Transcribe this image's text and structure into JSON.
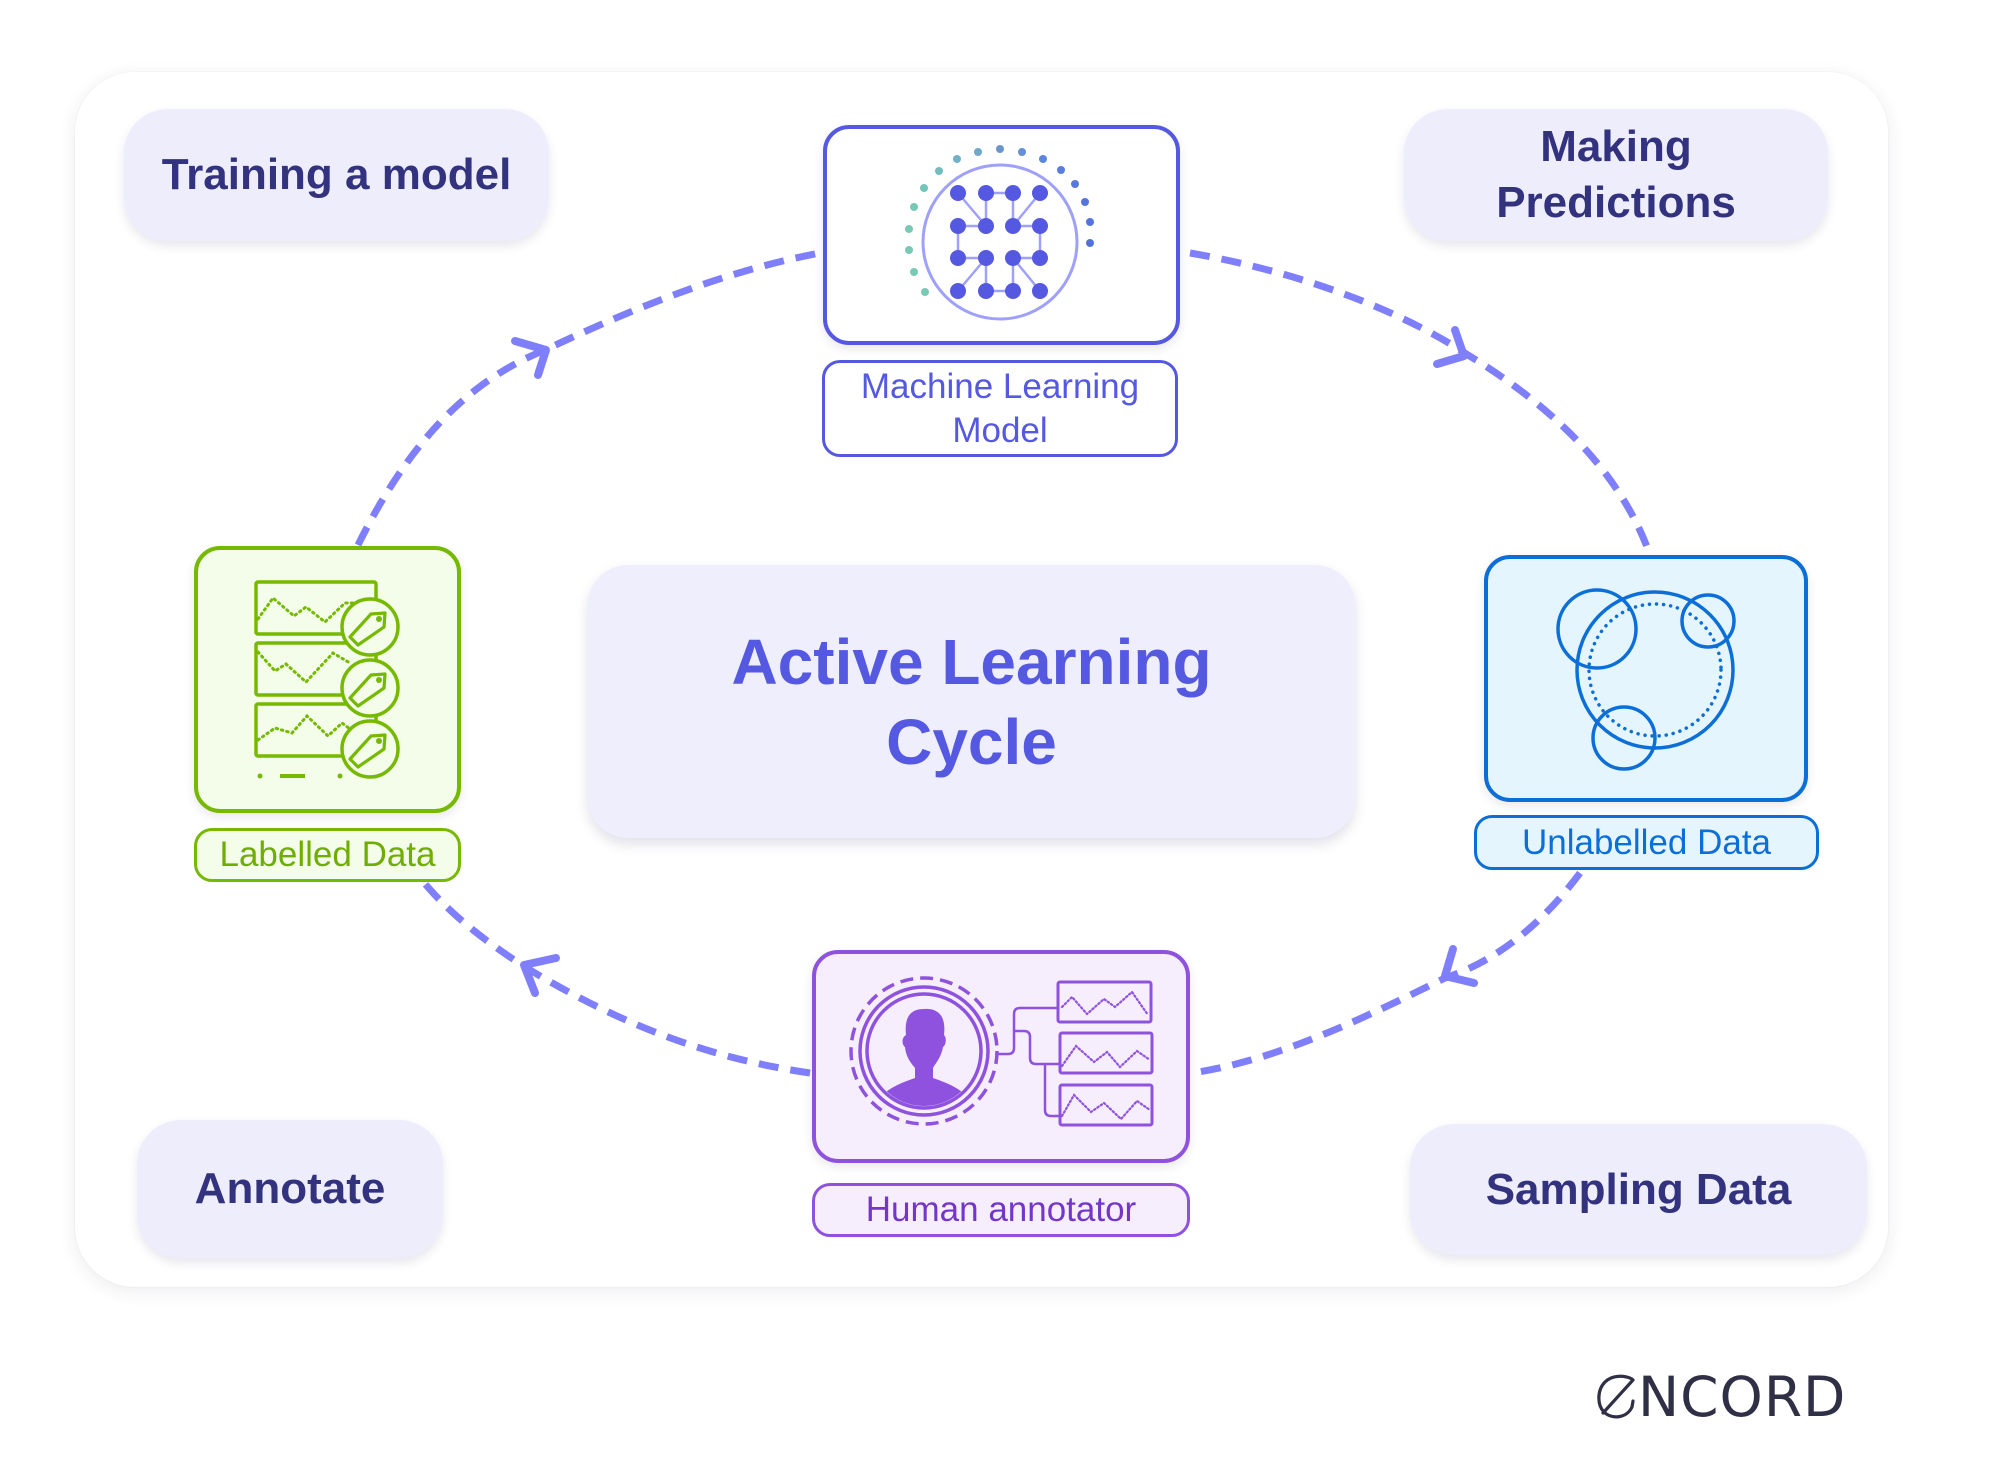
{
  "title": "Active Learning Cycle",
  "center": {
    "line1": "Active Learning",
    "line2": "Cycle"
  },
  "stages": {
    "training": {
      "label": "Training a model"
    },
    "predictions": {
      "line1": "Making",
      "line2": "Predictions"
    },
    "annotate": {
      "label": "Annotate"
    },
    "sampling": {
      "label": "Sampling Data"
    }
  },
  "nodes": {
    "ml_model": {
      "line1": "Machine Learning",
      "line2": "Model",
      "icon": "neural-network-icon",
      "color": "#5558e0"
    },
    "unlabelled": {
      "label": "Unlabelled Data",
      "icon": "data-clusters-icon",
      "color": "#0c6fd8"
    },
    "human": {
      "label": "Human annotator",
      "icon": "person-annotator-icon",
      "color": "#8f52de"
    },
    "labelled": {
      "label": "Labelled Data",
      "icon": "tagged-data-icon",
      "color": "#76b900"
    }
  },
  "flow": [
    {
      "from": "Labelled Data",
      "to": "Machine Learning Model",
      "stage": "Training a model"
    },
    {
      "from": "Machine Learning Model",
      "to": "Unlabelled Data",
      "stage": "Making Predictions"
    },
    {
      "from": "Unlabelled Data",
      "to": "Human annotator",
      "stage": "Sampling Data"
    },
    {
      "from": "Human annotator",
      "to": "Labelled Data",
      "stage": "Annotate"
    }
  ],
  "colors": {
    "arrow": "#7f7ffc",
    "stage_text": "#32327f",
    "title_text": "#5558e0",
    "logo": "#2f2f45"
  },
  "brand": {
    "name": "ENCORD",
    "name_rest": "NCORD"
  }
}
